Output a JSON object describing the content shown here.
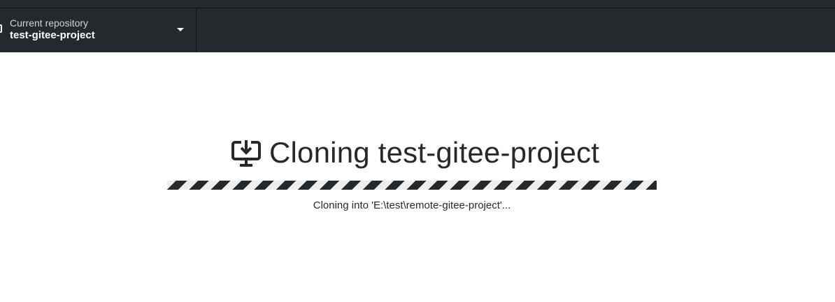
{
  "toolbar": {
    "repo_label": "Current repository",
    "repo_name": "test-gitee-project"
  },
  "main": {
    "title": "Cloning test-gitee-project",
    "status": "Cloning into 'E:\\test\\remote-gitee-project'..."
  },
  "icons": {
    "repo": "repo-icon",
    "chevron": "chevron-down-icon",
    "clone": "desktop-download-icon"
  },
  "colors": {
    "toolbar_bg": "#24292e",
    "text": "#24292e",
    "progress_stripe": "#24292e",
    "progress_gap": "#eeeeee"
  }
}
